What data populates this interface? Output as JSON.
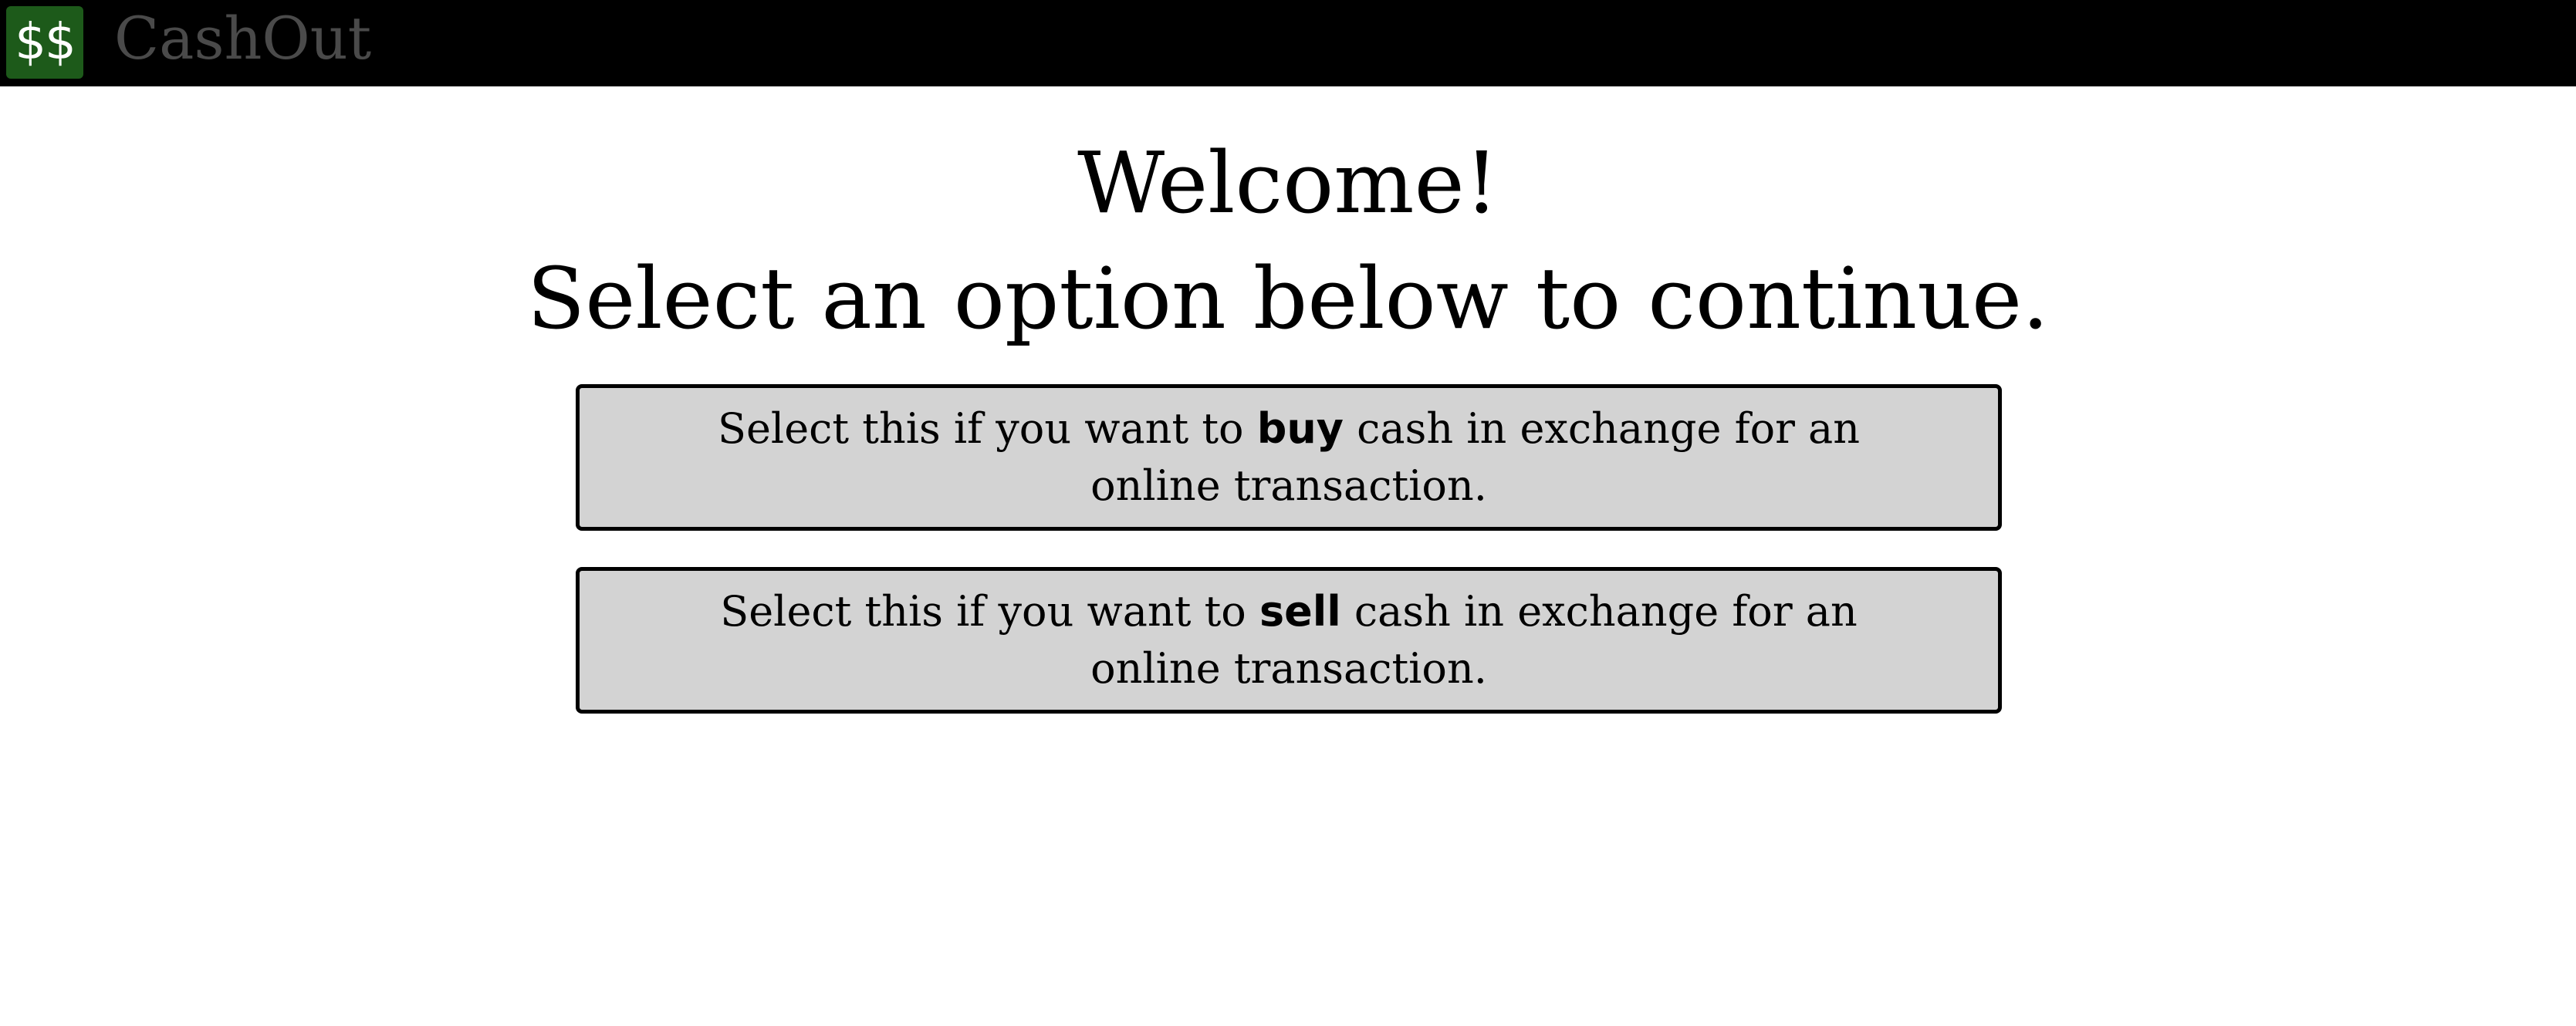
{
  "header": {
    "logo_text": "$$",
    "app_name": "CashOut",
    "logo_color": "#1d5a1a",
    "bar_color": "#000000"
  },
  "main": {
    "welcome": "Welcome!",
    "instruction": "Select an option below to continue."
  },
  "options": [
    {
      "prefix": "Select this if you want to ",
      "keyword": "buy",
      "suffix": " cash in exchange for an online transaction."
    },
    {
      "prefix": "Select this if you want to ",
      "keyword": "sell",
      "suffix": " cash in exchange for an online transaction."
    }
  ],
  "colors": {
    "option_background": "#d3d3d3"
  }
}
